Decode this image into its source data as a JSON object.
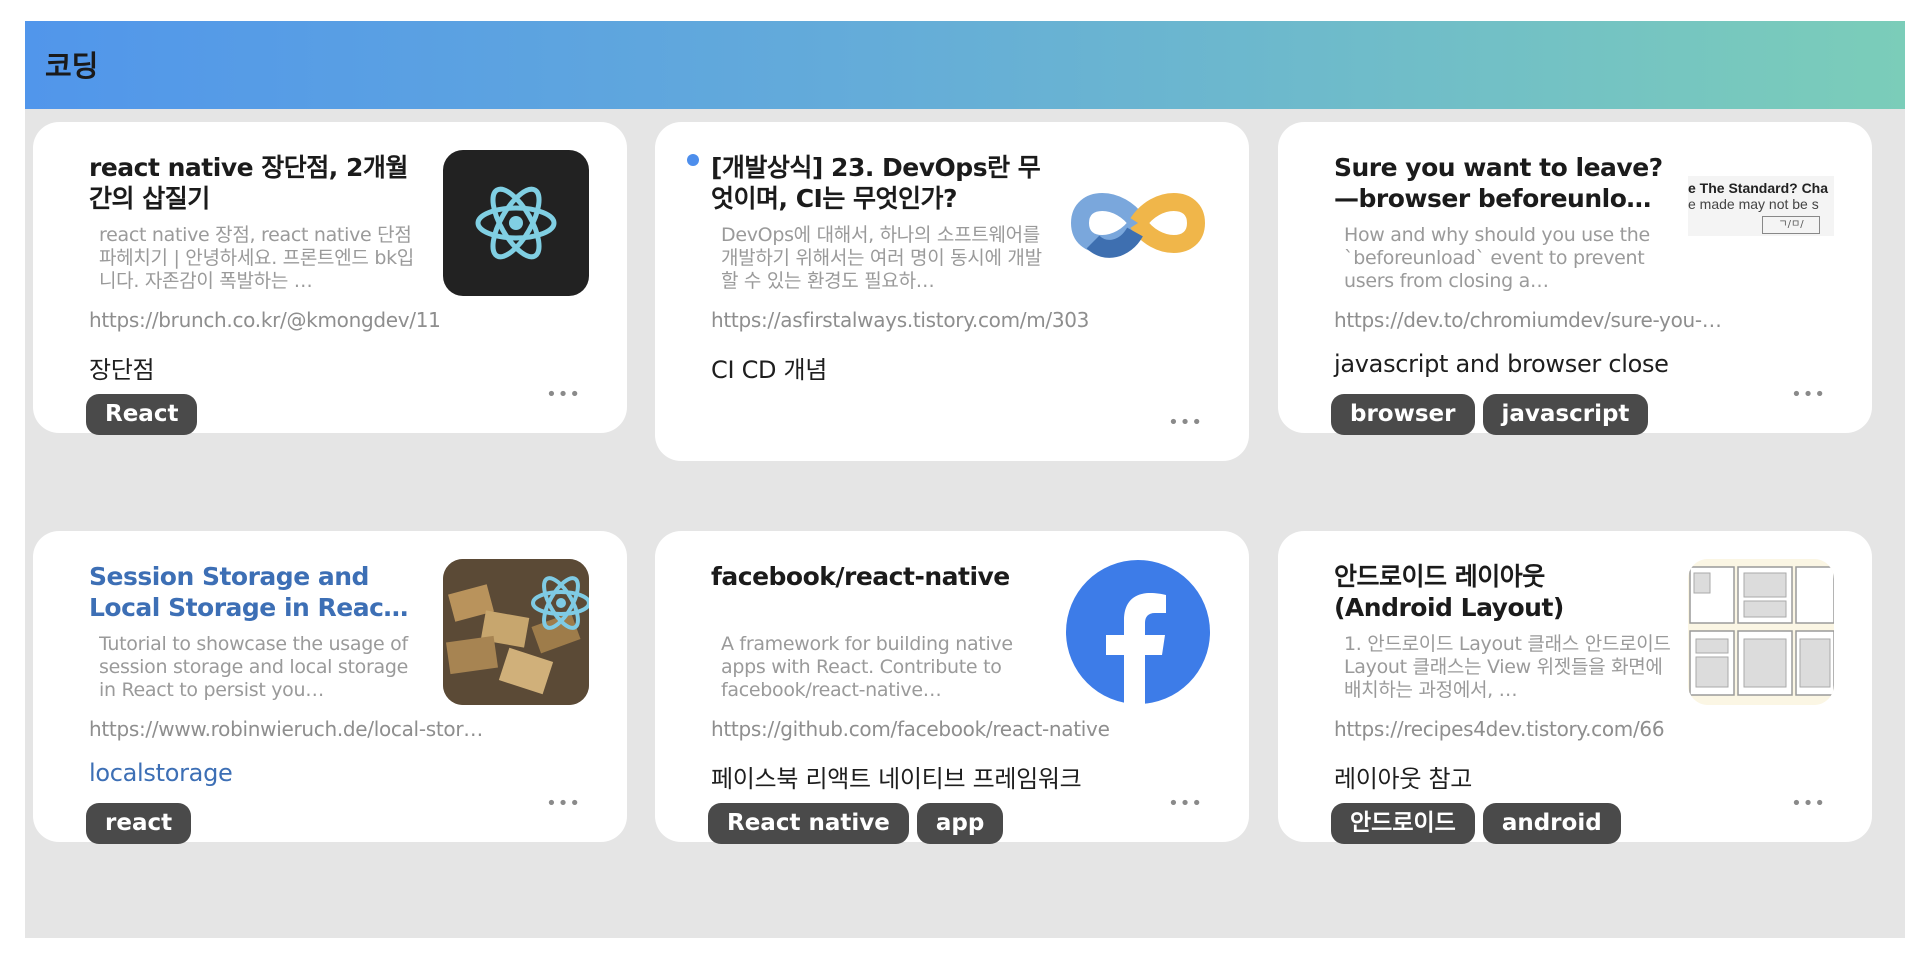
{
  "header": {
    "title": "코딩"
  },
  "cards": [
    {
      "title": "react native 장단점, 2개월간의 삽질기",
      "description": "react native 장점, react native 단점 파헤치기 | 안녕하세요. 프론트엔드 bk입니다. 자존감이 폭발하는 …",
      "url": "https://brunch.co.kr/@kmongdev/11",
      "memo": "장단점",
      "tags": [
        "React"
      ],
      "more": "•••",
      "thumbnail_icon": "react-logo-icon"
    },
    {
      "title": "[개발상식] 23. DevOps란 무엇이며, CI는 무엇인가?",
      "description": "DevOps에 대해서, 하나의 소프트웨어를 개발하기 위해서는 여러 명이 동시에 개발할 수 있는 환경도 필요하…",
      "url": "https://asfirstalways.tistory.com/m/303",
      "memo": "CI CD 개념",
      "tags": [],
      "more": "•••",
      "thumbnail_icon": "devops-infinity-icon",
      "unread_dot_color": "#4d8eec"
    },
    {
      "title": "Sure you want to leave?—browser beforeunload event",
      "description": "How and why should you use the `beforeunload` event to prevent users from closing a…",
      "url": "https://dev.to/chromiumdev/sure-you-want-to-leave",
      "memo": "javascript and browser close",
      "tags": [
        "browser",
        "javascript"
      ],
      "more": "•••",
      "thumbnail_icon": "browser-dialog-screenshot-icon",
      "thumbnail_text": {
        "line1": "e The Standard? Cha",
        "line2": "e made may not be s",
        "button": "ㄱ/ㅁ/"
      }
    },
    {
      "title": "Session Storage and Local Storage in React …",
      "description": "Tutorial to showcase the usage of session storage and local storage in React to persist you…",
      "url": "https://www.robinwieruch.de/local-storage-react",
      "memo": "localstorage",
      "tags": [
        "react"
      ],
      "more": "•••",
      "thumbnail_icon": "woodpile-react-logo-icon"
    },
    {
      "title": "facebook/react-native",
      "description": "A framework for building native apps with React. Contribute to facebook/react-native…",
      "url": "https://github.com/facebook/react-native",
      "memo": "페이스북 리액트 네이티브 프레임워크",
      "tags": [
        "React native",
        "app"
      ],
      "more": "•••",
      "thumbnail_icon": "facebook-logo-icon"
    },
    {
      "title": "안드로이드 레이아웃 (Android Layout)",
      "description": "1. 안드로이드 Layout 클래스 안드로이드 Layout 클래스는 View 위젯들을 화면에 배치하는 과정에서, …",
      "url": "https://recipes4dev.tistory.com/66",
      "memo": "레이아웃 참고",
      "tags": [
        "안드로이드",
        "android"
      ],
      "more": "•••",
      "thumbnail_icon": "android-layout-diagram-icon"
    }
  ],
  "colors": {
    "header_gradient": [
      "#5196eb",
      "#7bcdb9"
    ],
    "tag_bg": "#4a4a4a",
    "link_text": "#3d6fb5",
    "background": "#e5e5e5"
  }
}
